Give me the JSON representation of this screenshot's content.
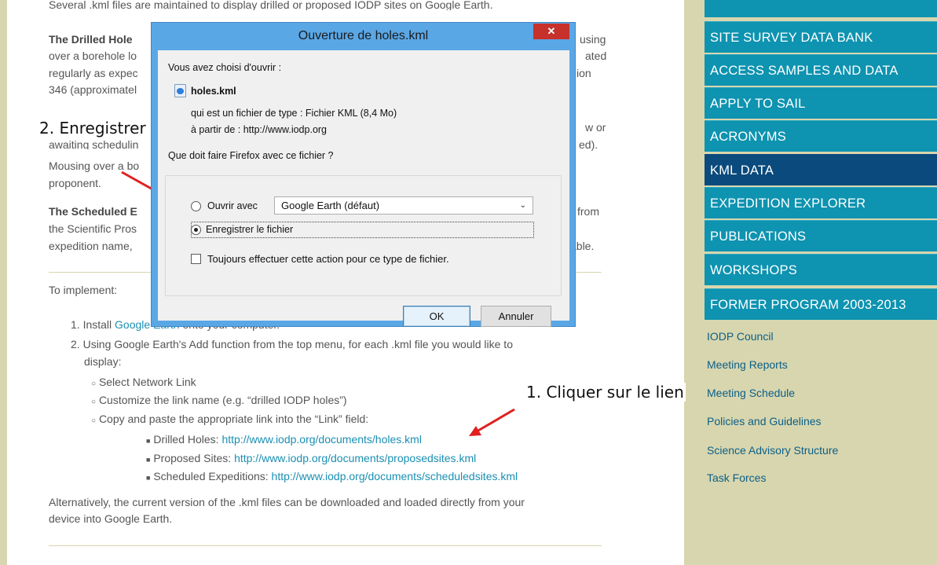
{
  "content": {
    "top_cut_text": "Several .kml files are maintained to display drilled or proposed IODP sites on Google Earth.",
    "p1": {
      "lead": "The Drilled Hole",
      "line1_right": "using",
      "line2_left": "over a borehole lo",
      "line2_right": "ated",
      "line3_left": "regularly as expec",
      "line3_right": "ion",
      "line4_left": "346 (approximatel"
    },
    "p2": {
      "line1_right": "w or",
      "line2_left": "awaiting schedulin",
      "line2_right": "ed).",
      "line3_left": "Mousing over a bo",
      "line4_left": "proponent."
    },
    "p3": {
      "lead": "The Scheduled E",
      "line1_right": "from",
      "line2_left": "the Scientific Pros",
      "line3_left": "expedition name,",
      "line3_right": "able."
    },
    "to_implement": "To implement:",
    "steps": {
      "s1_num": "1.",
      "s1_pre": "Install",
      "s1_link": "Google Earth",
      "s1_post": "onto your computer.",
      "s2_num": "2.",
      "s2_text": "Using Google Earth's Add function from the top menu, for each .kml file you would like to",
      "s2_text_cont": "display:",
      "sub1": "Select Network Link",
      "sub2": "Customize the link name (e.g. “drilled IODP holes”)",
      "sub3": "Copy and paste the appropriate link into the “Link” field:",
      "b1_label": "Drilled Holes:",
      "b1_link": "http://www.iodp.org/documents/holes.kml",
      "b2_label": "Proposed Sites:",
      "b2_link": "http://www.iodp.org/documents/proposedsites.kml",
      "b3_label": "Scheduled Expeditions:",
      "b3_link": "http://www.iodp.org/documents/scheduledsites.kml"
    },
    "alt_line1": "Alternatively, the current version of the .kml files can be downloaded and loaded directly from your",
    "alt_line2": "device into Google Earth."
  },
  "annotations": {
    "step1": "1. Cliquer sur le lien",
    "step2": "2. Enregistrer"
  },
  "sidebar": {
    "nav": [
      {
        "label": "SITE SURVEY DATA BANK"
      },
      {
        "label": "ACCESS SAMPLES AND DATA"
      },
      {
        "label": "APPLY TO SAIL"
      },
      {
        "label": "ACRONYMS"
      },
      {
        "label": "KML DATA"
      },
      {
        "label": "EXPEDITION EXPLORER"
      },
      {
        "label": "PUBLICATIONS"
      },
      {
        "label": "WORKSHOPS"
      },
      {
        "label": "FORMER PROGRAM 2003-2013"
      }
    ],
    "sub": [
      {
        "label": "IODP Council"
      },
      {
        "label": "Meeting Reports"
      },
      {
        "label": "Meeting Schedule"
      },
      {
        "label": "Policies and Guidelines"
      },
      {
        "label": "Science Advisory Structure"
      },
      {
        "label": "Task Forces"
      }
    ]
  },
  "dialog": {
    "title": "Ouverture de holes.kml",
    "close": "✕",
    "chosen": "Vous avez choisi d'ouvrir :",
    "filename": "holes.kml",
    "type_line": "qui est un fichier de type : Fichier KML (8,4 Mo)",
    "from_line": "à partir de : http://www.iodp.org",
    "question": "Que doit faire Firefox avec ce fichier ?",
    "open_with_label": "Ouvrir avec",
    "open_with_value": "Google Earth (défaut)",
    "save_label": "Enregistrer le fichier",
    "always_label": "Toujours effectuer cette action pour ce type de fichier.",
    "ok": "OK",
    "cancel": "Annuler"
  },
  "colors": {
    "nav_bg": "#0e93b0",
    "nav_active": "#0b4a7c",
    "sidebar_bg": "#d8d6ae",
    "link": "#1a8fb3",
    "arrow": "#e02020"
  }
}
